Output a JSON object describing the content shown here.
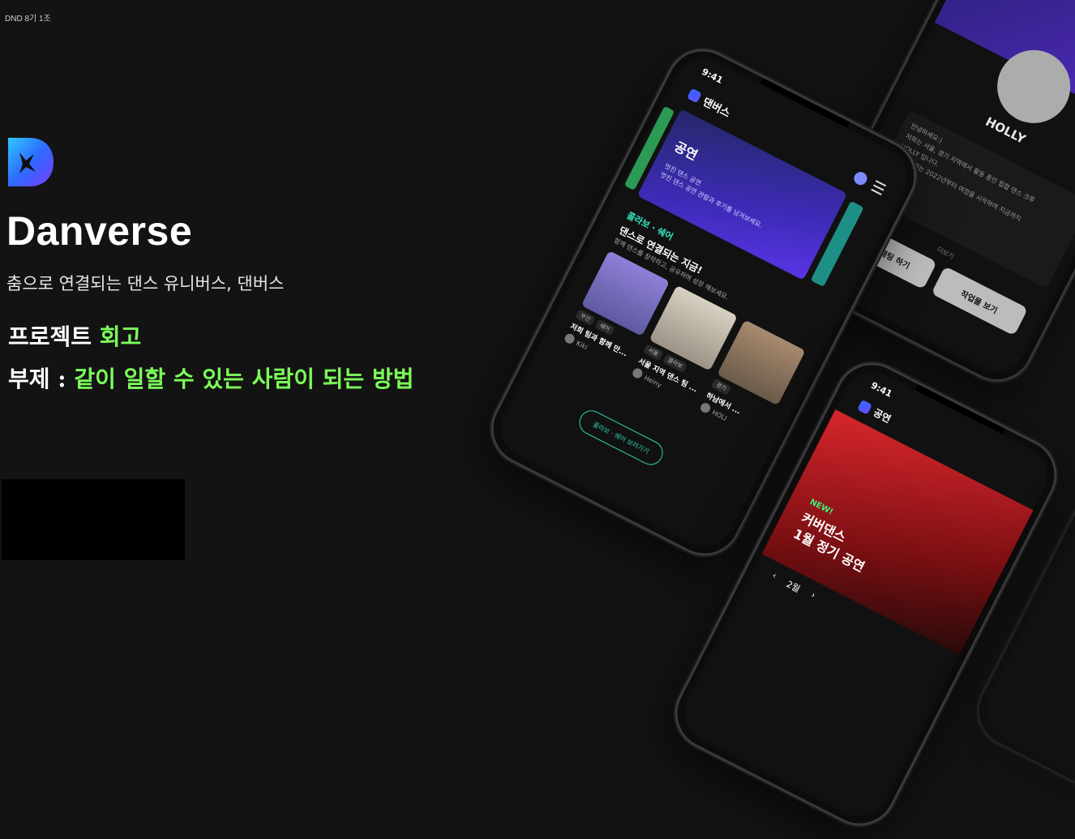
{
  "corner_tag": "DND 8기 1조",
  "brand": {
    "name": "Danverse",
    "tagline": "춤으로 연결되는 댄스 유니버스, 댄버스"
  },
  "headline": {
    "line1_prefix": "프로젝트 ",
    "line1_highlight": "회고",
    "line2_prefix": "부제 : ",
    "line2_highlight": "같이 일할 수 있는 사람이 되는 방법"
  },
  "colors": {
    "background": "#131313",
    "highlight": "#7cff5a",
    "accent_teal": "#2fd0b4",
    "brand_blue": "#2d6bff"
  },
  "phone_main": {
    "time": "9:41",
    "app_name": "댄버스",
    "banner": {
      "title": "공연",
      "sub1": "멋진 댄스 공연",
      "sub2": "멋진 댄스 공연 관람과 후기를 남겨보세요."
    },
    "section": {
      "tag": "콜라보 · 쉐어",
      "title": "댄스로 연결되는 지금!",
      "desc": "함께 댄스를 창작하고, 공유하며 성장 해보세요."
    },
    "cards": [
      {
        "chip1": "부산",
        "chip2": "쉐어",
        "title": "저희 팀과 함께 만...",
        "user": "Kiki"
      },
      {
        "chip1": "서울",
        "chip2": "콜라보",
        "title": "서울 지역 댄스 팀 ...",
        "user": "Heiny"
      },
      {
        "chip1": "경기",
        "chip2": "",
        "title": "하남에서 ...",
        "user": "HOLI"
      }
    ],
    "cta": "콜라보 · 쉐어 보러가기"
  },
  "phone_top": {
    "name": "HOLLY",
    "bio1": "안녕하세요:)",
    "bio2": "저희는 서울, 경기 지역에서 활동 중인 힙합 댄스 크루",
    "bio3": "HOLLY 입니다.",
    "bio4": "저희 홀리는 2022년부터 여정을 시작하여 지금까지",
    "more": "더보기",
    "btn_chat": "오픈채팅 하기",
    "btn_works": "작업물 보기"
  },
  "phone_bottom": {
    "time": "9:41",
    "title": "공연",
    "badge": "NEW!",
    "perf_line1": "커버댄스",
    "perf_line2": "1월 정기 공연",
    "month": "2월"
  }
}
